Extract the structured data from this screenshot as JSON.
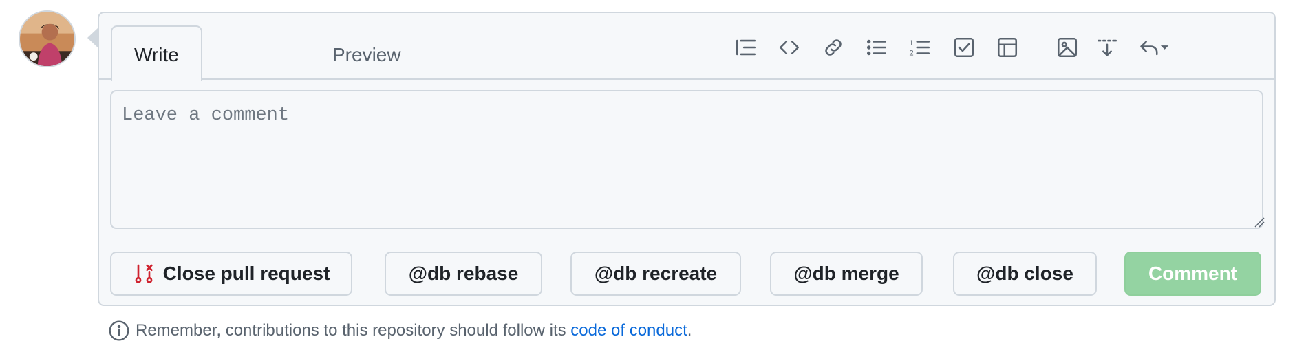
{
  "avatar": {
    "alt": "user avatar"
  },
  "tabs": [
    {
      "label": "Write",
      "active": true
    },
    {
      "label": "Preview",
      "active": false
    }
  ],
  "toolbar": {
    "icons": [
      "heading-icon",
      "code-icon",
      "link-icon",
      "bulleted-list-icon",
      "numbered-list-icon",
      "task-list-icon",
      "table-icon",
      "image-icon",
      "insert-icon",
      "reply-icon",
      "chevron-down-icon"
    ]
  },
  "editor": {
    "placeholder": "Leave a comment",
    "value": ""
  },
  "actions": {
    "close_pr": "Close pull request",
    "rebase": "@db rebase",
    "recreate": "@db recreate",
    "merge": "@db merge",
    "close": "@db close",
    "comment": "Comment"
  },
  "note": {
    "text_before": "Remember, contributions to this repository should follow its",
    "link_text": "code of conduct",
    "text_after": "."
  },
  "colors": {
    "border": "#d0d7de",
    "background": "#f6f8fa",
    "close_icon": "#cf222e",
    "comment_button": "#94d3a2",
    "link": "#0969da"
  }
}
